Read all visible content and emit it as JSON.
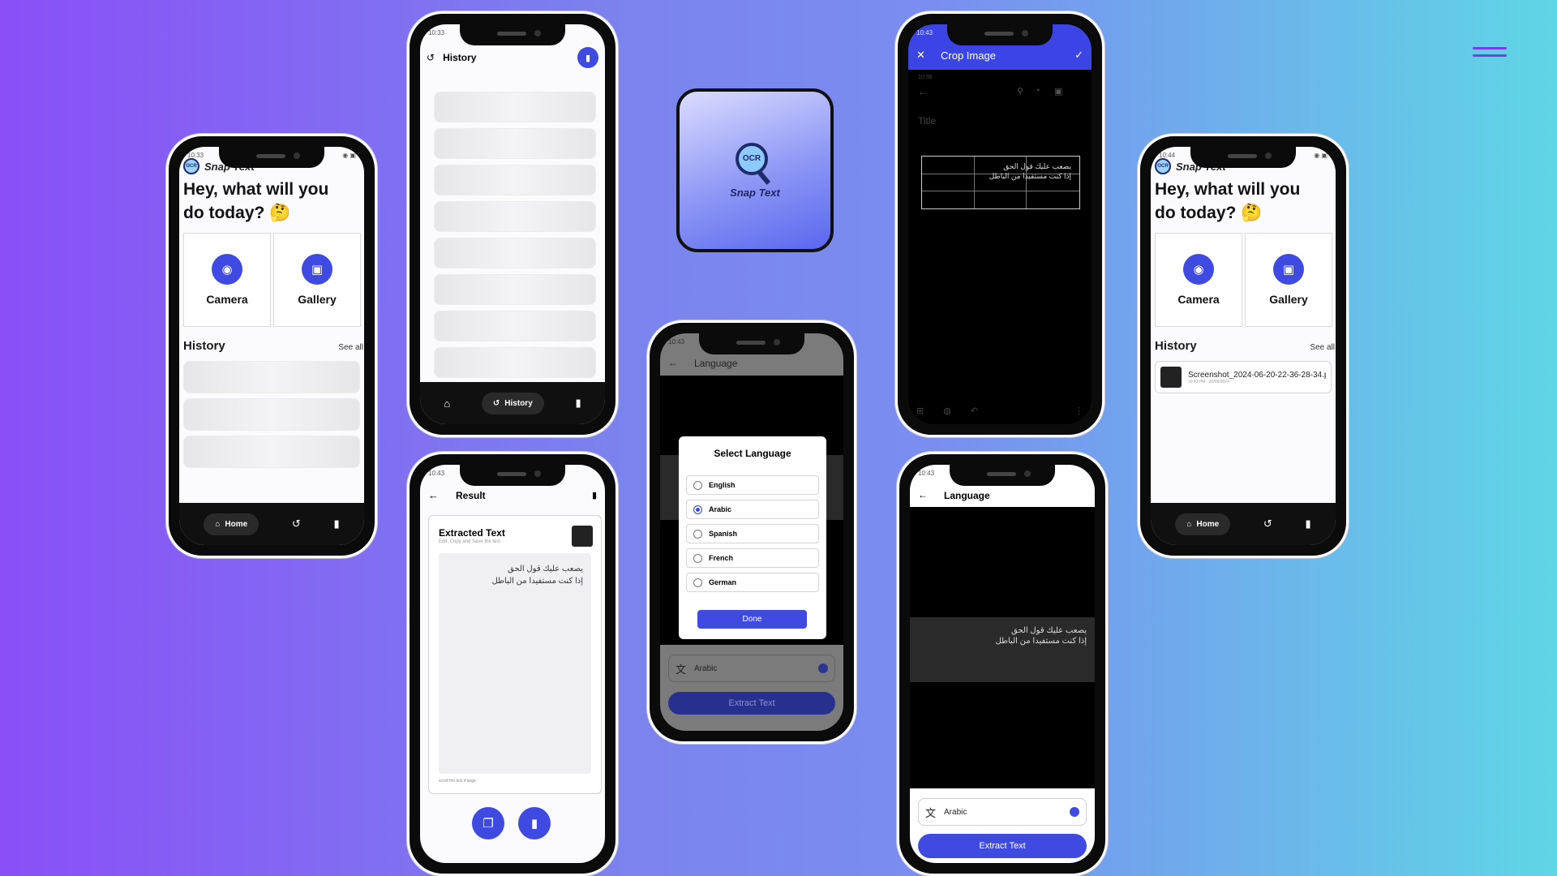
{
  "phone1": {
    "time": "10:33",
    "brand": "Snap Text",
    "greeting": "Hey, what will you do today? 🤔",
    "camera_label": "Camera",
    "gallery_label": "Gallery",
    "history_title": "History",
    "see_all": "See all",
    "nav_home": "Home"
  },
  "phone2": {
    "time": "10:33",
    "title": "History",
    "nav_history": "History"
  },
  "logo": {
    "ocr": "OCR",
    "name": "Snap Text"
  },
  "phone4": {
    "time": "10:43",
    "title": "Crop Image",
    "inner_time": "10:36",
    "note_title_placeholder": "Title",
    "arabic_line1": "يصعب عليك قول الحق",
    "arabic_line2": "إذا كنت مستفيدا من الباطل"
  },
  "phone5": {
    "time": "10:44",
    "brand": "Snap Text",
    "greeting": "Hey, what will you do today? 🤔",
    "camera_label": "Camera",
    "gallery_label": "Gallery",
    "history_title": "History",
    "see_all": "See all",
    "history_item_name": "Screenshot_2024-06-20-22-36-28-34.p",
    "history_item_meta": "10:43 PM - 20/06/2024",
    "nav_home": "Home"
  },
  "phone6": {
    "time": "10:43",
    "title": "Result",
    "card_title": "Extracted Text",
    "card_subtitle": "Edit, Copy and Save the text",
    "arabic_line1": "يصعب عليك قول الحق",
    "arabic_line2": "إذا كنت مستفيدا من الباطل",
    "hint": "scroll the text if large"
  },
  "phone7": {
    "time": "10:43",
    "title": "Language",
    "dialog_title": "Select Language",
    "options": [
      "English",
      "Arabic",
      "Spanish",
      "French",
      "German"
    ],
    "selected": "Arabic",
    "done": "Done",
    "lang_value": "Arabic",
    "extract": "Extract Text"
  },
  "phone8": {
    "time": "10:43",
    "title": "Language",
    "arabic_line1": "يصعب عليك قول الحق",
    "arabic_line2": "إذا كنت مستفيدا من الباطل",
    "lang_value": "Arabic",
    "extract": "Extract Text"
  },
  "colors": {
    "primary": "#3f4be0",
    "bg_start": "#8a4ff7",
    "bg_end": "#5fd6e6"
  }
}
